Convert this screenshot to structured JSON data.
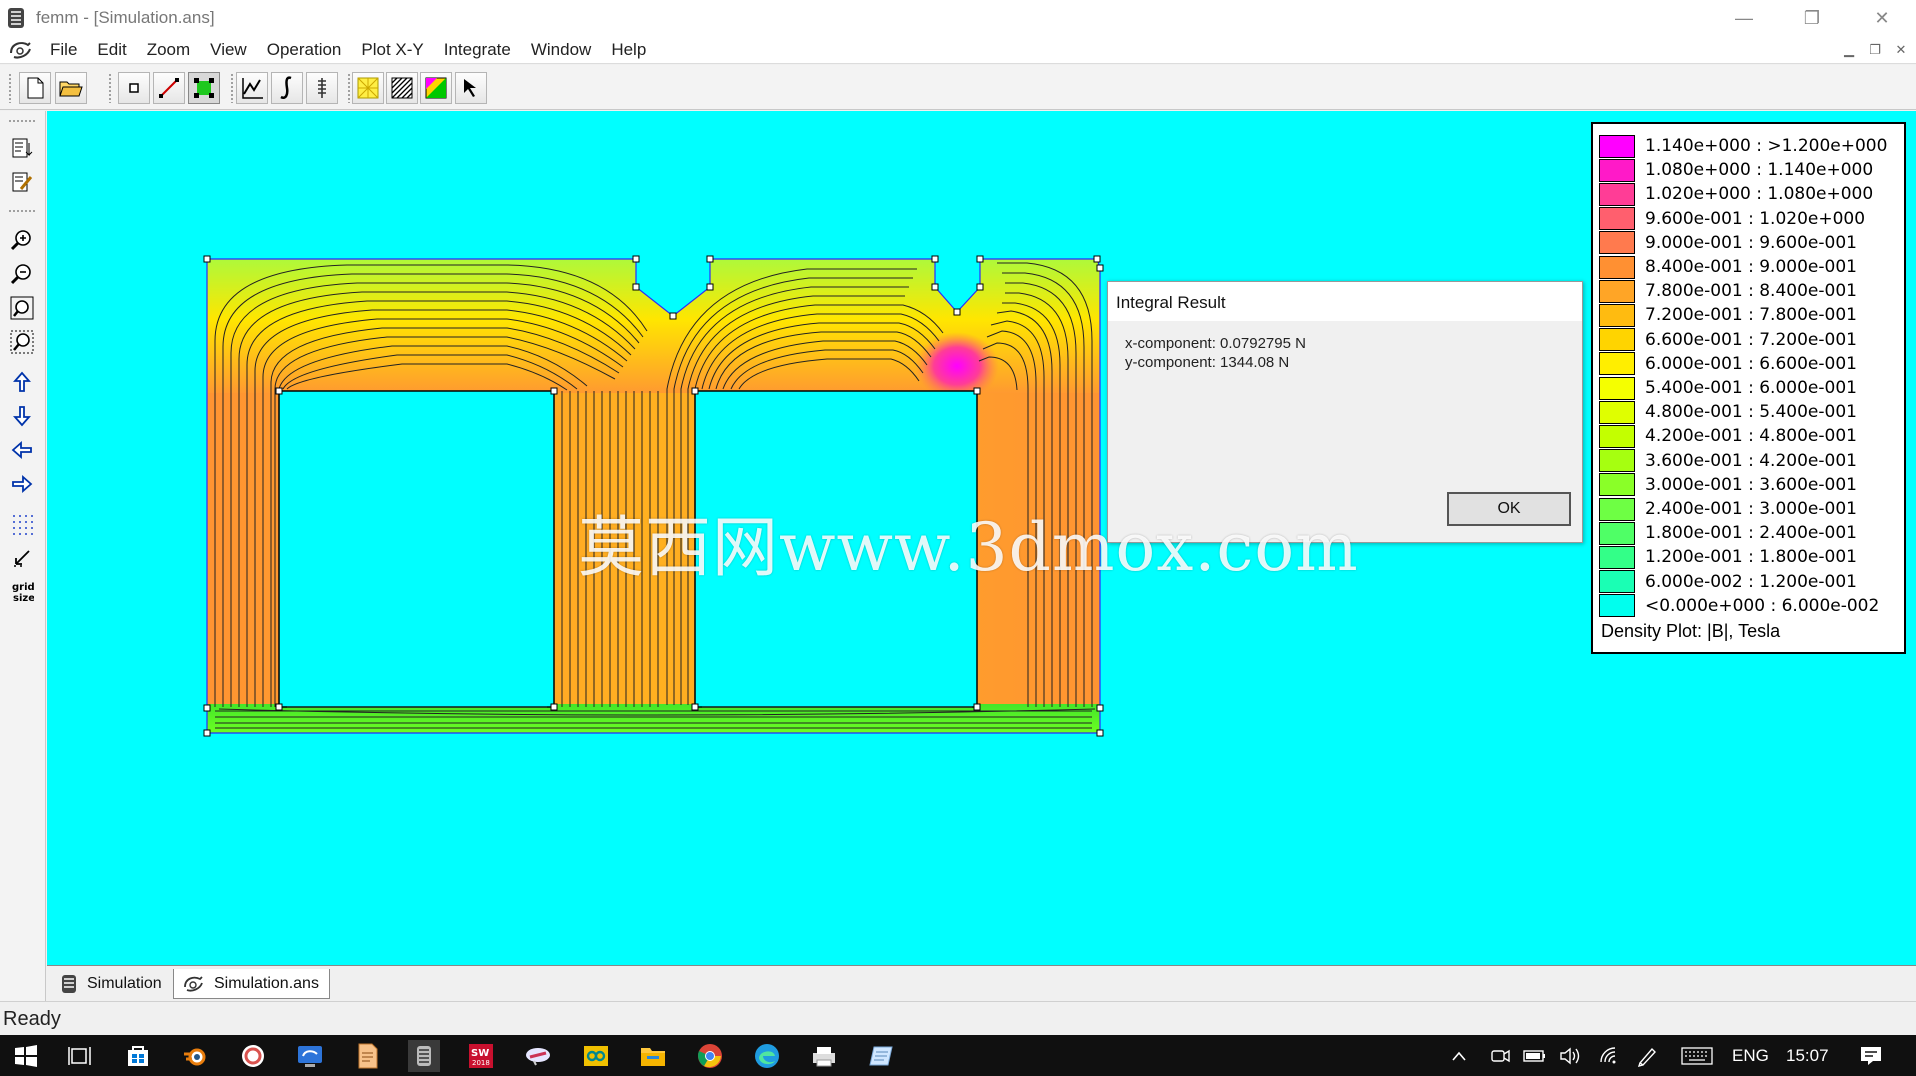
{
  "titlebar": {
    "title": "femm - [Simulation.ans]"
  },
  "menu": [
    "File",
    "Edit",
    "Zoom",
    "View",
    "Operation",
    "Plot X-Y",
    "Integrate",
    "Window",
    "Help"
  ],
  "dialog": {
    "title": "Integral Result",
    "x_component": "x-component: 0.0792795 N",
    "y_component": "y-component: 1344.08 N",
    "ok_label": "OK"
  },
  "legend": {
    "title": "Density Plot: |B|, Tesla",
    "entries": [
      {
        "label": "1.140e+000 : >1.200e+000",
        "color": "#ff00ff"
      },
      {
        "label": "1.080e+000 : 1.140e+000",
        "color": "#ff1ac8"
      },
      {
        "label": "1.020e+000 : 1.080e+000",
        "color": "#ff3d96"
      },
      {
        "label": "9.600e-001 : 1.020e+000",
        "color": "#ff5f6e"
      },
      {
        "label": "9.000e-001 : 9.600e-001",
        "color": "#ff7a4e"
      },
      {
        "label": "8.400e-001 : 9.000e-001",
        "color": "#ff9032"
      },
      {
        "label": "7.800e-001 : 8.400e-001",
        "color": "#ffa526"
      },
      {
        "label": "7.200e-001 : 7.800e-001",
        "color": "#ffbb10"
      },
      {
        "label": "6.600e-001 : 7.200e-001",
        "color": "#ffd400"
      },
      {
        "label": "6.000e-001 : 6.600e-001",
        "color": "#ffee00"
      },
      {
        "label": "5.400e-001 : 6.000e-001",
        "color": "#f5ff00"
      },
      {
        "label": "4.800e-001 : 5.400e-001",
        "color": "#dfff00"
      },
      {
        "label": "4.200e-001 : 4.800e-001",
        "color": "#c3ff00"
      },
      {
        "label": "3.600e-001 : 4.200e-001",
        "color": "#a6ff10"
      },
      {
        "label": "3.000e-001 : 3.600e-001",
        "color": "#8aff28"
      },
      {
        "label": "2.400e-001 : 3.000e-001",
        "color": "#6eff44"
      },
      {
        "label": "1.800e-001 : 2.400e-001",
        "color": "#4fff66"
      },
      {
        "label": "1.200e-001 : 1.800e-001",
        "color": "#33ff88"
      },
      {
        "label": "6.000e-002 : 1.200e-001",
        "color": "#1affb4"
      },
      {
        "label": "<0.000e+000 : 6.000e-002",
        "color": "#00ffee"
      }
    ]
  },
  "tabs": [
    {
      "label": "Simulation"
    },
    {
      "label": "Simulation.ans"
    }
  ],
  "status": {
    "text": "Ready"
  },
  "taskbar": {
    "language": "ENG",
    "time": "15:07"
  },
  "watermark": "莫西网www.3dmox.com",
  "plot_colors": {
    "background": "#00ffff",
    "core_low": "#22dd22",
    "core_mid": "#ffee00",
    "core_high": "#ff9a30",
    "hotspot": "#ff00ff"
  }
}
